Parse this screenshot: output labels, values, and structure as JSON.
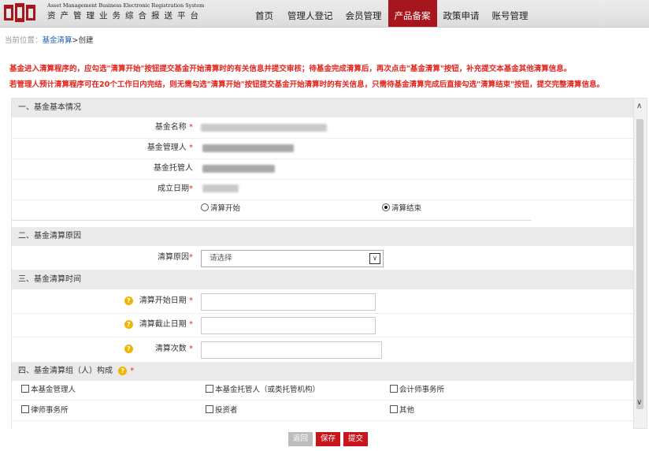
{
  "header": {
    "logo_en": "Asset Management Business Electronic Registration System",
    "logo_cn": "资产管理业务综合报送平台",
    "nav": [
      "首页",
      "管理人登记",
      "会员管理",
      "产品备案",
      "政策申请",
      "账号管理"
    ],
    "active_nav": "产品备案"
  },
  "breadcrumb": {
    "prefix": "当前位置：",
    "link": "基金清算",
    "sep": ">",
    "current": "创建"
  },
  "notes": [
    "基金进入清算程序的，应勾选\"清算开始\"按钮提交基金开始清算时的有关信息并提交审核；待基金完成清算后，再次点击\"基金清算\"按钮，补充提交本基金其他清算信息。",
    "若管理人预计清算程序可在20个工作日内完结，则无需勾选\"清算开始\"按钮提交基金开始清算时的有关信息，只需待基金清算完成后直接勾选\"清算结束\"按钮，提交完整清算信息。"
  ],
  "section1": {
    "title": "一、基金基本情况",
    "fund_name_label": "基金名称",
    "manager_label": "基金管理人",
    "custodian_label": "基金托管人",
    "established_label": "成立日期",
    "radio_start": "清算开始",
    "radio_end": "清算结束"
  },
  "section2": {
    "title": "二、基金清算原因",
    "reason_label": "清算原因",
    "reason_value": "请选择"
  },
  "section3": {
    "title": "三、基金清算时间",
    "start_label": "清算开始日期",
    "end_label": "清算截止日期",
    "count_label": "清算次数"
  },
  "section4": {
    "title": "四、基金清算组（人）构成",
    "options": [
      "本基金管理人",
      "本基金托管人（或类托管机构）",
      "会计师事务所",
      "律师事务所",
      "投资者",
      "其他"
    ]
  },
  "buttons": {
    "back": "返回",
    "save": "保存",
    "submit": "提交"
  },
  "colors": {
    "brand": "#a7161c",
    "notice": "#e5251d",
    "section_bg": "#eaeaea"
  }
}
